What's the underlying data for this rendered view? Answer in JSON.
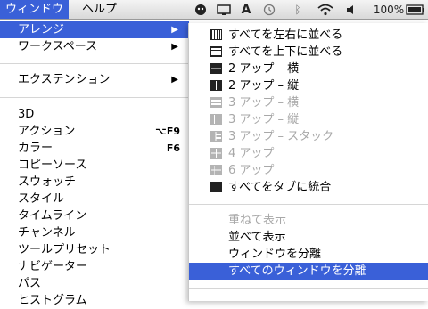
{
  "menubar": {
    "items": [
      {
        "label": "ウィンドウ",
        "active": true
      },
      {
        "label": "ヘルプ",
        "active": false
      }
    ],
    "status": {
      "battery": "100%"
    }
  },
  "left_menu": {
    "items": [
      {
        "label": "アレンジ",
        "arrow": "▶",
        "highlighted": true
      },
      {
        "label": "ワークスペース",
        "arrow": "▶"
      },
      {
        "label": "エクステンション",
        "arrow": "▶"
      },
      {
        "label": "3D"
      },
      {
        "label": "アクション",
        "shortcut": "⌥F9"
      },
      {
        "label": "カラー",
        "shortcut": "F6"
      },
      {
        "label": "コピーソース"
      },
      {
        "label": "スウォッチ"
      },
      {
        "label": "スタイル"
      },
      {
        "label": "タイムライン"
      },
      {
        "label": "チャンネル"
      },
      {
        "label": "ツールプリセット"
      },
      {
        "label": "ナビゲーター"
      },
      {
        "label": "パス"
      },
      {
        "label": "ヒストグラム"
      }
    ]
  },
  "submenu": {
    "items": [
      {
        "label": "すべてを左右に並べる",
        "icon": "columns-icon"
      },
      {
        "label": "すべてを上下に並べる",
        "icon": "rows-icon"
      },
      {
        "label": "2 アップ – 横",
        "icon": "two-up-horizontal-icon"
      },
      {
        "label": "2 アップ – 縦",
        "icon": "two-up-vertical-icon"
      },
      {
        "label": "3 アップ – 横",
        "icon": "three-up-horizontal-icon",
        "disabled": true
      },
      {
        "label": "3 アップ – 縦",
        "icon": "three-up-vertical-icon",
        "disabled": true
      },
      {
        "label": "3 アップ – スタック",
        "icon": "three-up-stack-icon",
        "disabled": true
      },
      {
        "label": "4 アップ",
        "icon": "four-up-icon",
        "disabled": true
      },
      {
        "label": "6 アップ",
        "icon": "six-up-icon",
        "disabled": true
      },
      {
        "label": "すべてをタブに統合",
        "icon": "consolidate-tabs-icon"
      },
      {
        "label": "重ねて表示",
        "disabled": true
      },
      {
        "label": "並べて表示"
      },
      {
        "label": "ウィンドウを分離"
      },
      {
        "label": "すべてのウィンドウを分離",
        "highlighted": true
      }
    ]
  },
  "colors": {
    "highlight": "#3a60d8",
    "disabled_text": "#a8a8a8"
  }
}
